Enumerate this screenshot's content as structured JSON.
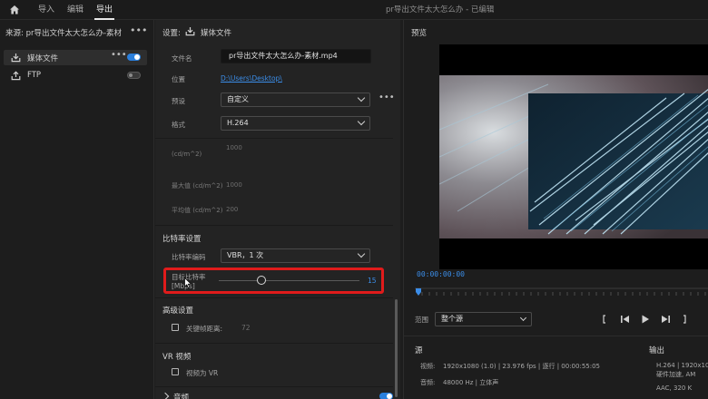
{
  "topbar": {
    "tabs": [
      "导入",
      "编辑",
      "导出"
    ],
    "active_tab": "导出",
    "document_title": "pr导出文件太大怎么办 - 已编辑"
  },
  "source": {
    "header": "来源:  pr导出文件太大怎么办-素材",
    "more": "•••",
    "items": [
      {
        "label": "媒体文件",
        "icon": "export-icon",
        "toggle": "on",
        "dots": "•••"
      },
      {
        "label": "FTP",
        "icon": "upload-icon",
        "toggle": "off"
      }
    ]
  },
  "settings": {
    "header": "设置:",
    "header_label": "媒体文件",
    "filename_label": "文件名",
    "filename_value": "pr导出文件太大怎么办-素材.mp4",
    "location_label": "位置",
    "location_value": "D:\\Users\\Desktop\\",
    "preset_label": "预设",
    "preset_value": "自定义",
    "preset_more": "•••",
    "format_label": "格式",
    "format_value": "H.264",
    "hdr_rows": [
      {
        "label": "(cd/m^2)",
        "value": "1000"
      },
      {
        "label": "最大值 (cd/m^2)",
        "value": "1000"
      },
      {
        "label": "平均值 (cd/m^2)",
        "value": "200"
      }
    ],
    "bitrate_section": "比特率设置",
    "bitrate_encoding_label": "比特率编码",
    "bitrate_encoding_value": "VBR，1 次",
    "target_bitrate_label": "目标比特率",
    "target_bitrate_unit": "[Mbps]",
    "target_bitrate_value": "15",
    "target_bitrate_fraction": 0.3,
    "advanced_section": "高级设置",
    "keyframe_label": "关键帧距离:",
    "keyframe_value": "72",
    "vr_section": "VR 视频",
    "vr_checkbox_label": "视频为 VR",
    "audio_section": "音频"
  },
  "preview": {
    "title": "预览",
    "timecode": "00:00:00:00",
    "range_label": "范围",
    "range_value": "整个源",
    "source_head": "源",
    "output_head": "输出",
    "source_video_label": "视频:",
    "source_video": "1920x1080 (1.0)  |  23.976 fps  |  逐行  |  00:00:55:05",
    "source_audio_label": "音频:",
    "source_audio": "48000 Hz  |  立体声",
    "output_video": "H.264  |  1920x10",
    "output_video2": "硬件加速, AM",
    "output_audio": "AAC, 320 K"
  },
  "colors": {
    "accent": "#2a7fdc",
    "highlight_box": "#e01b1b",
    "link": "#3b8de8"
  }
}
